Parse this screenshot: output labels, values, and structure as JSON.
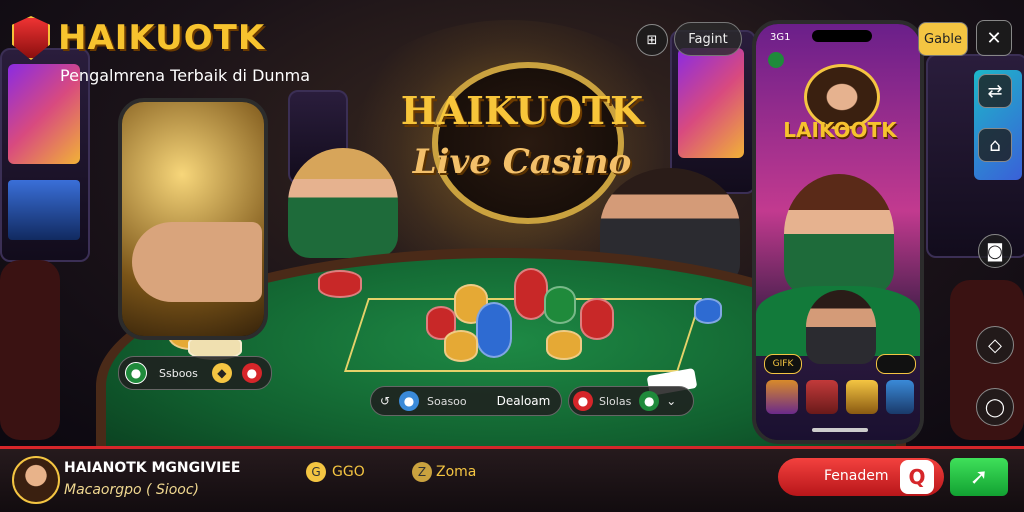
{
  "brand": {
    "logo_text": "HAIKUOTK",
    "tagline": "Pengalmrena Terbaik di Dunma"
  },
  "hero": {
    "title": "HAIKUOTK",
    "subtitle": "Live Casino"
  },
  "top_controls": {
    "pill_label": "Fagint",
    "right_pill_label": "Gable"
  },
  "right_phone": {
    "status_left": "3G1",
    "title": "LAIKOOTK",
    "badge_label": "GIFK"
  },
  "left_panel": {
    "label": "Ssboos"
  },
  "table_controls": {
    "left_label": "Soasoo",
    "dealer_label": "Dealoam",
    "right_label": "Slolas"
  },
  "bottom": {
    "user_name": "HAIANOTK MGNGIVIEE",
    "user_sub": "Macaorgpo ( Siooc)",
    "stat1_label": "GGO",
    "stat2_label": "Zoma",
    "action_label": "Fenadem"
  },
  "colors": {
    "gold": "#f7c32e",
    "red": "#d6262a",
    "green": "#1e8a45"
  },
  "icons": [
    "shield-logo-icon",
    "tools-icon",
    "settings-icon",
    "camera-icon",
    "diamond-icon",
    "chat-icon",
    "search-icon",
    "arrow-icon"
  ]
}
